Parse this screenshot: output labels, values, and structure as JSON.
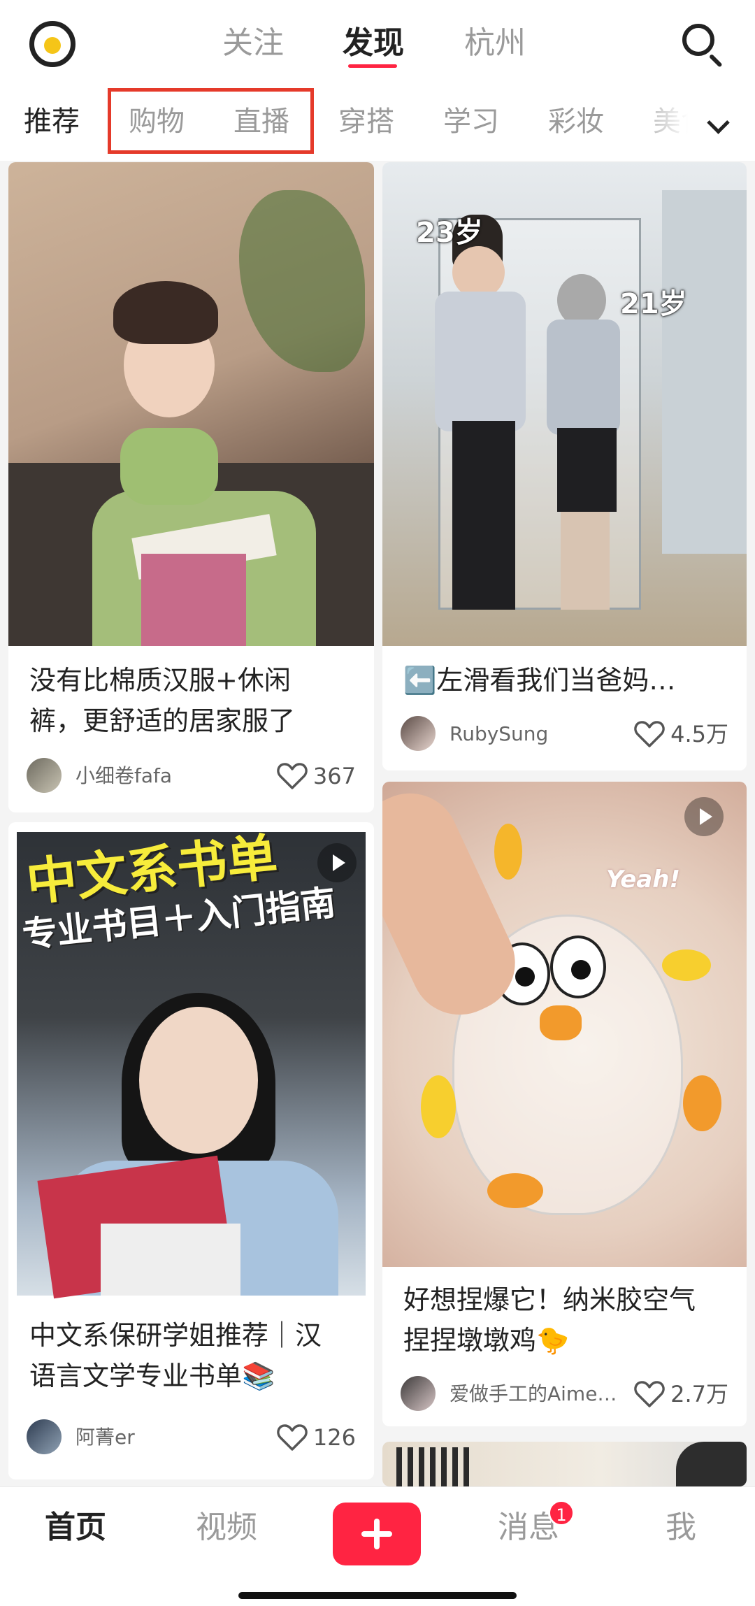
{
  "header": {
    "tabs": [
      {
        "label": "关注",
        "active": false
      },
      {
        "label": "发现",
        "active": true
      },
      {
        "label": "杭州",
        "active": false
      }
    ],
    "logo_icon": "app-logo-icon",
    "search_icon": "search-icon"
  },
  "categories": {
    "items": [
      "推荐",
      "购物",
      "直播",
      "穿搭",
      "学习",
      "彩妆",
      "美食"
    ],
    "active_index": 0,
    "highlight_color": "#e53a2a",
    "expand_icon": "chevron-down-icon"
  },
  "feed": {
    "cards": [
      {
        "title_lines": [
          "没有比棉质汉服+休闲",
          "裤，更舒适的居家服了"
        ],
        "author": "小细卷fafa",
        "likes": "367",
        "video": false
      },
      {
        "title_lines": [
          "⬅️左滑看我们当爸妈…"
        ],
        "author": "RubySung",
        "likes": "4.5万",
        "video": false,
        "image_tags": [
          "23岁",
          "21岁"
        ]
      },
      {
        "title_lines": [
          "中文系保研学姐推荐｜汉",
          "语言文学专业书单📚"
        ],
        "author": "阿菁er",
        "likes": "126",
        "video": true,
        "image_text": [
          "中文系书单",
          "专业书目＋入门指南"
        ]
      },
      {
        "title_lines": [
          "好想捏爆它！纳米胶空气",
          "捏捏墩墩鸡🐤"
        ],
        "author": "爱做手工的Aime…",
        "likes": "2.7万",
        "video": true,
        "image_text": [
          "Yeah!"
        ]
      }
    ]
  },
  "bottom_nav": {
    "items": [
      {
        "label": "首页",
        "active": true
      },
      {
        "label": "视频",
        "active": false
      },
      {
        "label": "消息",
        "active": false
      },
      {
        "label": "我",
        "active": false
      }
    ],
    "add_icon": "plus-icon",
    "message_badge": "1"
  },
  "colors": {
    "accent": "#ff2442",
    "highlight_box": "#e53a2a"
  }
}
